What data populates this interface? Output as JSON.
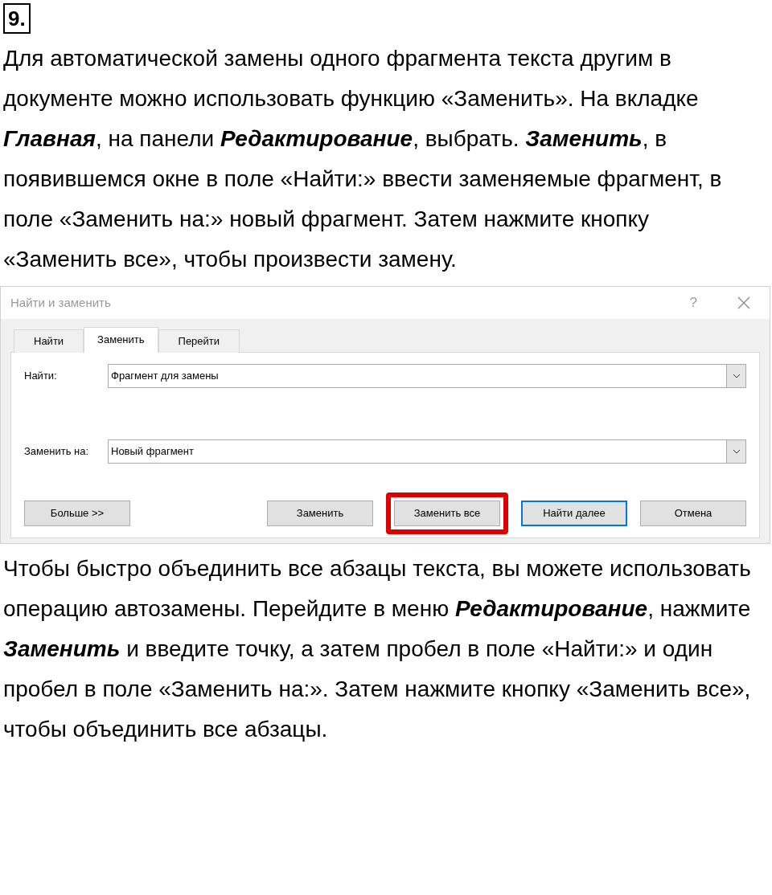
{
  "task_number": "9.",
  "paragraphs_before": [
    "Для автоматической замены одного фрагмента текста другим в документе можно использовать функцию «Заменить». На вкладке **Главная**, на панели **Редактирование**, выбрать. **Заменить**, в появившемся окне в поле «Найти:» ввести заменяемые фрагмент, в поле «Заменить на:» новый фрагмент. Затем нажмите кнопку «Заменить все», чтобы произвести замену."
  ],
  "dialog": {
    "title": "Найти и заменить",
    "help": "?",
    "tabs": [
      {
        "label": "Найти",
        "selected": false
      },
      {
        "label": "Заменить",
        "selected": true
      },
      {
        "label": "Перейти",
        "selected": false
      }
    ],
    "fields": [
      {
        "label": "Найти:",
        "value": "Фрагмент для замены"
      },
      {
        "label": "Заменить на:",
        "value": "Новый фрагмент"
      }
    ],
    "buttons": [
      {
        "label": "Больше >>",
        "focused": false,
        "highlighted": false
      },
      {
        "label": "Заменить",
        "focused": false,
        "highlighted": false
      },
      {
        "label": "Заменить все",
        "focused": false,
        "highlighted": true
      },
      {
        "label": "Найти далее",
        "focused": true,
        "highlighted": false
      },
      {
        "label": "Отмена",
        "focused": false,
        "highlighted": false
      }
    ]
  },
  "paragraphs_after": [
    "Чтобы быстро объединить все абзацы текста, вы можете использовать операцию автозамены. Перейдите в меню **Редактирование**, нажмите **Заменить** и введите точку, а затем пробел в поле «Найти:» и один пробел в поле «Заменить на:». Затем нажмите кнопку «Заменить все», чтобы объединить все абзацы."
  ]
}
